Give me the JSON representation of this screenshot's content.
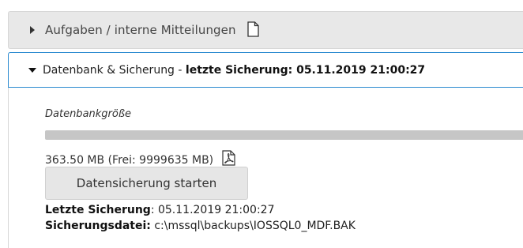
{
  "sections": {
    "tasks": {
      "label": "Aufgaben / interne Mitteilungen",
      "icon": "document-icon"
    },
    "database": {
      "label_prefix": "Datenbank & Sicherung - ",
      "label_bold": "letzte Sicherung: 05.11.2019 21:00:27",
      "size_label": "Datenbankgröße",
      "size_used_fraction": 1.0,
      "size_text": "363.50 MB (Frei: 9999635 MB)",
      "pdf_icon": "pdf-icon",
      "backup_button": "Datensicherung starten",
      "last_backup_label": "Letzte Sicherung",
      "last_backup_value": ": 05.11.2019 21:00:27",
      "backup_file_label": "Sicherungsdatei:",
      "backup_file_value": " c:\\mssql\\backups\\IOSSQL0_MDF.BAK"
    }
  },
  "colors": {
    "accent_border": "#2a8ad0",
    "header_bg": "#e8e8e8",
    "button_bg": "#e6e6e6"
  }
}
